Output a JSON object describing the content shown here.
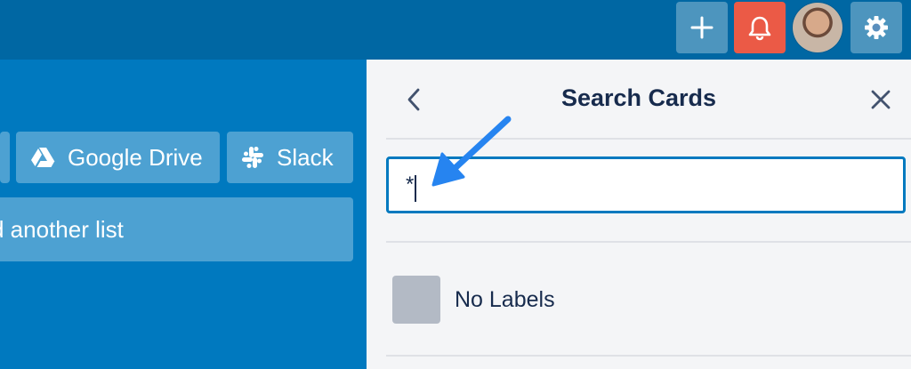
{
  "header": {
    "add_icon": "plus-icon",
    "notifications_icon": "bell-icon",
    "settings_icon": "gear-icon",
    "colors": {
      "bar": "#0067a3",
      "notification_bg": "#eb5a46"
    }
  },
  "board": {
    "powerups": [
      {
        "label": "Google Drive",
        "icon": "google-drive-icon"
      },
      {
        "label": "Slack",
        "icon": "slack-icon"
      }
    ],
    "add_list_label": "d another list",
    "background": "#0079bf"
  },
  "search_panel": {
    "title": "Search Cards",
    "back_icon": "chevron-left-icon",
    "close_icon": "close-icon",
    "search_value": "*",
    "labels": [
      {
        "name": "No Labels",
        "color": "#b3bac5"
      }
    ]
  },
  "annotation": {
    "arrow_color": "#2684f0"
  }
}
